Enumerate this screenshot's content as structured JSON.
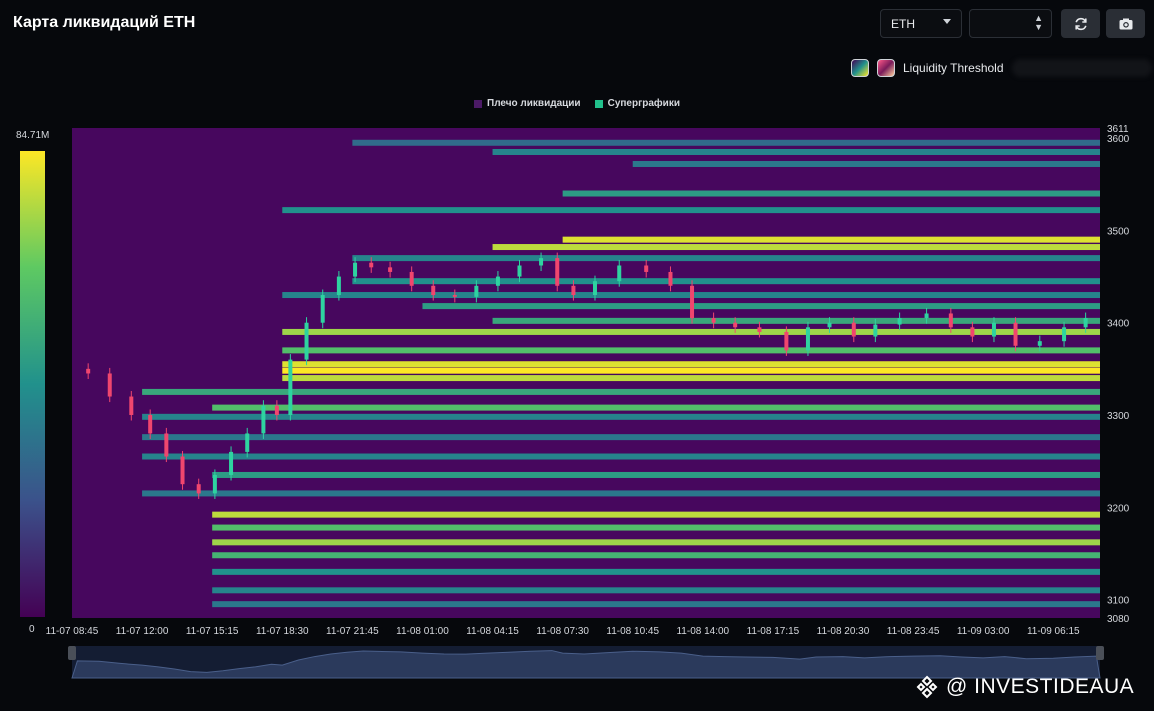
{
  "header": {
    "title": "Карта ликвидаций ETH",
    "asset_select": "ETH"
  },
  "threshold": {
    "label": "Liquidity Threshold"
  },
  "legend": [
    {
      "label": "Плечо ликвидации",
      "color": "#4b1a66"
    },
    {
      "label": "Суперграфики",
      "color": "#21c08b"
    }
  ],
  "color_scale": {
    "max_label": "84.71M",
    "min_label": "0"
  },
  "watermark": {
    "text": "@ INVESTIDEAUA"
  },
  "icons": {
    "refresh": "refresh-icon",
    "camera": "camera-icon",
    "logo": "binance-logo-icon"
  },
  "chart_data": {
    "type": "heatmap",
    "ylim": [
      3080,
      3611
    ],
    "y_ticks": [
      3611,
      3600,
      3500,
      3400,
      3300,
      3200,
      3100,
      3080
    ],
    "x_ticks": [
      "11-07 08:45",
      "11-07 12:00",
      "11-07 15:15",
      "11-07 18:30",
      "11-07 21:45",
      "11-08 01:00",
      "11-08 04:15",
      "11-08 07:30",
      "11-08 10:45",
      "11-08 14:00",
      "11-08 17:15",
      "11-08 20:30",
      "11-08 23:45",
      "11-09 03:00",
      "11-09 06:15"
    ],
    "x_range": [
      "11-07 08:45",
      "11-09 08:25"
    ],
    "series_price": [
      [
        "11-07 09:00",
        3350
      ],
      [
        "11-07 10:00",
        3345
      ],
      [
        "11-07 11:00",
        3320
      ],
      [
        "11-07 12:00",
        3300
      ],
      [
        "11-07 12:45",
        3280
      ],
      [
        "11-07 13:30",
        3255
      ],
      [
        "11-07 14:15",
        3225
      ],
      [
        "11-07 15:00",
        3215
      ],
      [
        "11-07 15:45",
        3235
      ],
      [
        "11-07 16:30",
        3260
      ],
      [
        "11-07 17:15",
        3280
      ],
      [
        "11-07 18:00",
        3310
      ],
      [
        "11-07 18:30",
        3300
      ],
      [
        "11-07 19:15",
        3360
      ],
      [
        "11-07 20:00",
        3400
      ],
      [
        "11-07 20:45",
        3430
      ],
      [
        "11-07 21:30",
        3450
      ],
      [
        "11-07 22:15",
        3465
      ],
      [
        "11-07 23:00",
        3460
      ],
      [
        "11-08 00:00",
        3455
      ],
      [
        "11-08 01:00",
        3440
      ],
      [
        "11-08 02:00",
        3430
      ],
      [
        "11-08 03:00",
        3428
      ],
      [
        "11-08 04:00",
        3440
      ],
      [
        "11-08 05:00",
        3450
      ],
      [
        "11-08 06:00",
        3462
      ],
      [
        "11-08 07:00",
        3470
      ],
      [
        "11-08 07:30",
        3440
      ],
      [
        "11-08 08:30",
        3430
      ],
      [
        "11-08 09:30",
        3445
      ],
      [
        "11-08 10:45",
        3462
      ],
      [
        "11-08 12:00",
        3455
      ],
      [
        "11-08 13:00",
        3440
      ],
      [
        "11-08 14:00",
        3405
      ],
      [
        "11-08 15:00",
        3400
      ],
      [
        "11-08 16:00",
        3395
      ],
      [
        "11-08 17:15",
        3390
      ],
      [
        "11-08 18:30",
        3370
      ],
      [
        "11-08 19:15",
        3395
      ],
      [
        "11-08 20:30",
        3400
      ],
      [
        "11-08 21:30",
        3385
      ],
      [
        "11-08 22:30",
        3398
      ],
      [
        "11-08 23:45",
        3405
      ],
      [
        "11-09 01:00",
        3410
      ],
      [
        "11-09 02:00",
        3395
      ],
      [
        "11-09 03:00",
        3385
      ],
      [
        "11-09 04:00",
        3400
      ],
      [
        "11-09 05:00",
        3375
      ],
      [
        "11-09 06:15",
        3380
      ],
      [
        "11-09 07:15",
        3395
      ],
      [
        "11-09 08:15",
        3405
      ]
    ],
    "liquidation_bands": [
      {
        "price": 3595,
        "start": "11-07 21:45",
        "intensity": 0.35
      },
      {
        "price": 3585,
        "start": "11-08 04:15",
        "intensity": 0.45
      },
      {
        "price": 3572,
        "start": "11-08 10:45",
        "intensity": 0.4
      },
      {
        "price": 3540,
        "start": "11-08 07:30",
        "intensity": 0.55
      },
      {
        "price": 3522,
        "start": "11-07 18:30",
        "intensity": 0.5
      },
      {
        "price": 3490,
        "start": "11-08 07:30",
        "intensity": 0.95
      },
      {
        "price": 3482,
        "start": "11-08 04:15",
        "intensity": 0.9
      },
      {
        "price": 3470,
        "start": "11-07 21:45",
        "intensity": 0.45
      },
      {
        "price": 3445,
        "start": "11-07 21:45",
        "intensity": 0.5
      },
      {
        "price": 3430,
        "start": "11-07 18:30",
        "intensity": 0.45
      },
      {
        "price": 3418,
        "start": "11-08 01:00",
        "intensity": 0.55
      },
      {
        "price": 3402,
        "start": "11-08 04:15",
        "intensity": 0.6
      },
      {
        "price": 3390,
        "start": "11-07 18:30",
        "intensity": 0.85
      },
      {
        "price": 3370,
        "start": "11-07 18:30",
        "intensity": 0.7
      },
      {
        "price": 3355,
        "start": "11-07 18:30",
        "intensity": 0.95
      },
      {
        "price": 3348,
        "start": "11-07 18:30",
        "intensity": 1.0
      },
      {
        "price": 3340,
        "start": "11-07 18:30",
        "intensity": 0.9
      },
      {
        "price": 3325,
        "start": "11-07 12:00",
        "intensity": 0.6
      },
      {
        "price": 3308,
        "start": "11-07 15:15",
        "intensity": 0.7
      },
      {
        "price": 3298,
        "start": "11-07 12:00",
        "intensity": 0.45
      },
      {
        "price": 3276,
        "start": "11-07 12:00",
        "intensity": 0.4
      },
      {
        "price": 3255,
        "start": "11-07 12:00",
        "intensity": 0.45
      },
      {
        "price": 3235,
        "start": "11-07 15:15",
        "intensity": 0.55
      },
      {
        "price": 3215,
        "start": "11-07 12:00",
        "intensity": 0.4
      },
      {
        "price": 3192,
        "start": "11-07 15:15",
        "intensity": 0.9
      },
      {
        "price": 3178,
        "start": "11-07 15:15",
        "intensity": 0.7
      },
      {
        "price": 3162,
        "start": "11-07 15:15",
        "intensity": 0.85
      },
      {
        "price": 3148,
        "start": "11-07 15:15",
        "intensity": 0.65
      },
      {
        "price": 3130,
        "start": "11-07 15:15",
        "intensity": 0.5
      },
      {
        "price": 3110,
        "start": "11-07 15:15",
        "intensity": 0.45
      },
      {
        "price": 3095,
        "start": "11-07 15:15",
        "intensity": 0.4
      }
    ]
  }
}
